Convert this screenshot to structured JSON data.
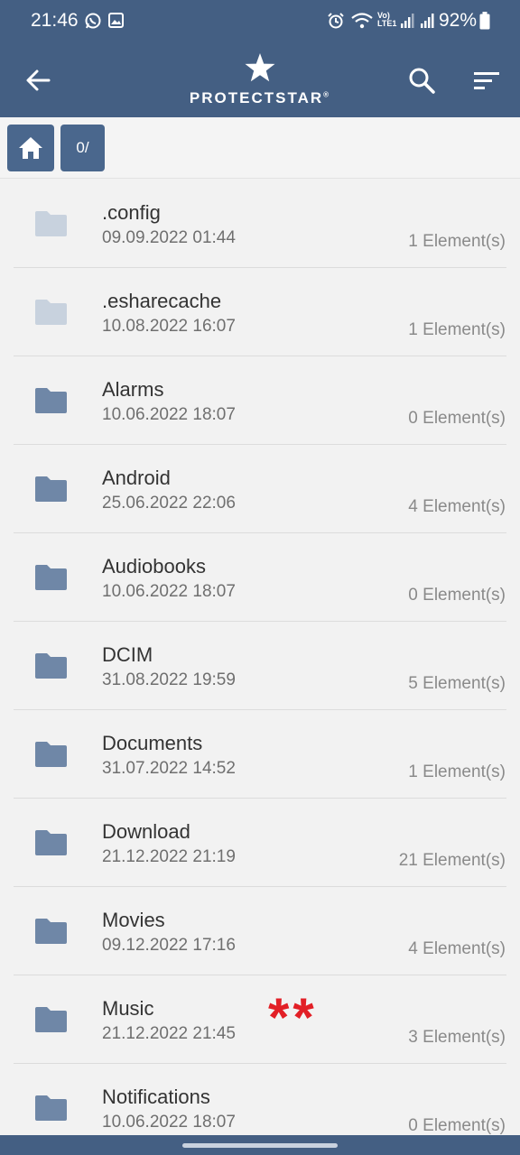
{
  "status": {
    "time": "21:46",
    "battery": "92%",
    "volte_label": "Vo) LTE1"
  },
  "app": {
    "brand": "PROTECTSTAR",
    "trademark": "®"
  },
  "breadcrumb": {
    "path_label": "0/"
  },
  "folders": [
    {
      "name": ".config",
      "date": "09.09.2022 01:44",
      "count": "1 Element(s)",
      "hidden": true
    },
    {
      "name": ".esharecache",
      "date": "10.08.2022 16:07",
      "count": "1 Element(s)",
      "hidden": true
    },
    {
      "name": "Alarms",
      "date": "10.06.2022 18:07",
      "count": "0 Element(s)",
      "hidden": false
    },
    {
      "name": "Android",
      "date": "25.06.2022 22:06",
      "count": "4 Element(s)",
      "hidden": false
    },
    {
      "name": "Audiobooks",
      "date": "10.06.2022 18:07",
      "count": "0 Element(s)",
      "hidden": false
    },
    {
      "name": "DCIM",
      "date": "31.08.2022 19:59",
      "count": "5 Element(s)",
      "hidden": false
    },
    {
      "name": "Documents",
      "date": "31.07.2022 14:52",
      "count": "1 Element(s)",
      "hidden": false
    },
    {
      "name": "Download",
      "date": "21.12.2022 21:19",
      "count": "21 Element(s)",
      "hidden": false
    },
    {
      "name": "Movies",
      "date": "09.12.2022 17:16",
      "count": "4 Element(s)",
      "hidden": false
    },
    {
      "name": "Music",
      "date": "21.12.2022 21:45",
      "count": "3 Element(s)",
      "hidden": false
    },
    {
      "name": "Notifications",
      "date": "10.06.2022 18:07",
      "count": "0 Element(s)",
      "hidden": false
    }
  ],
  "annotation": {
    "marker": "**"
  },
  "colors": {
    "bar": "#445f83",
    "crumb": "#4a678d",
    "folder": "#6f87a7",
    "folder_hidden": "#c8d2de",
    "marker": "#e21f26"
  },
  "icons": [
    "whatsapp-icon",
    "gallery-icon",
    "alarm-icon",
    "wifi-icon",
    "signal-icon",
    "battery-icon",
    "back-arrow-icon",
    "star-logo-icon",
    "search-icon",
    "sort-icon",
    "home-icon",
    "folder-icon"
  ]
}
